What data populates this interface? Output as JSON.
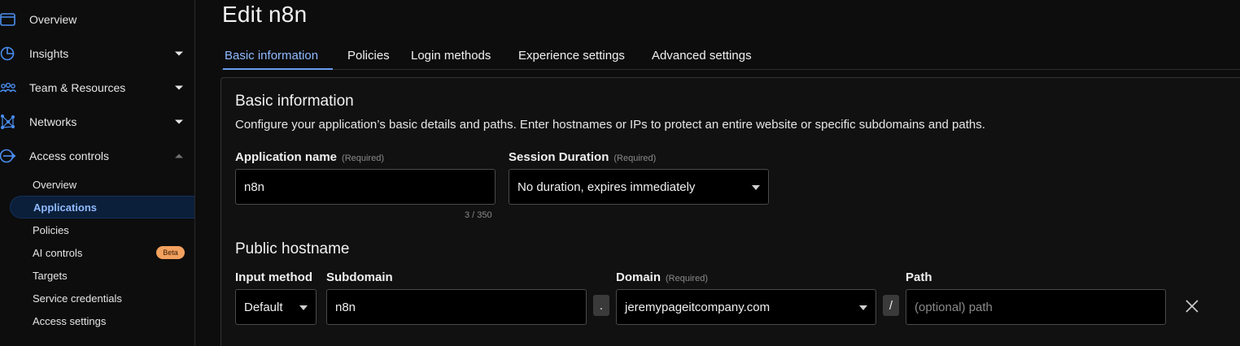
{
  "sidebar": {
    "items": [
      {
        "label": "Overview",
        "icon": "browser-window-icon"
      },
      {
        "label": "Insights",
        "icon": "pie-chart-icon"
      },
      {
        "label": "Team & Resources",
        "icon": "team-icon"
      },
      {
        "label": "Networks",
        "icon": "network-icon"
      },
      {
        "label": "Access controls",
        "icon": "access-icon"
      }
    ],
    "sub_items": [
      {
        "label": "Overview"
      },
      {
        "label": "Applications"
      },
      {
        "label": "Policies"
      },
      {
        "label": "AI controls"
      },
      {
        "label": "Targets"
      },
      {
        "label": "Service credentials"
      },
      {
        "label": "Access settings"
      }
    ],
    "beta_badge": "Beta"
  },
  "page": {
    "title": "Edit n8n"
  },
  "tabs": [
    {
      "label": "Basic information"
    },
    {
      "label": "Policies"
    },
    {
      "label": "Login methods"
    },
    {
      "label": "Experience settings"
    },
    {
      "label": "Advanced settings"
    }
  ],
  "basic": {
    "title": "Basic information",
    "description": "Configure your application’s basic details and paths. Enter hostnames or IPs to protect an entire website or specific subdomains and paths.",
    "app_name_label": "Application name",
    "app_name_required": "(Required)",
    "app_name_value": "n8n",
    "app_name_counter": "3 / 350",
    "session_label": "Session Duration",
    "session_required": "(Required)",
    "session_value": "No duration, expires immediately"
  },
  "hostname": {
    "title": "Public hostname",
    "input_method_label": "Input method",
    "input_method_value": "Default",
    "subdomain_label": "Subdomain",
    "subdomain_value": "n8n",
    "dot": ".",
    "domain_label": "Domain",
    "domain_required": "(Required)",
    "domain_value": "jeremypageitcompany.com",
    "slash": "/",
    "path_label": "Path",
    "path_placeholder": "(optional) path"
  },
  "colors": {
    "accent": "#8fbaff",
    "icon_blue": "#4a8ff0",
    "beta_bg": "#f3a15f",
    "active_bg": "#0b1f3a"
  }
}
